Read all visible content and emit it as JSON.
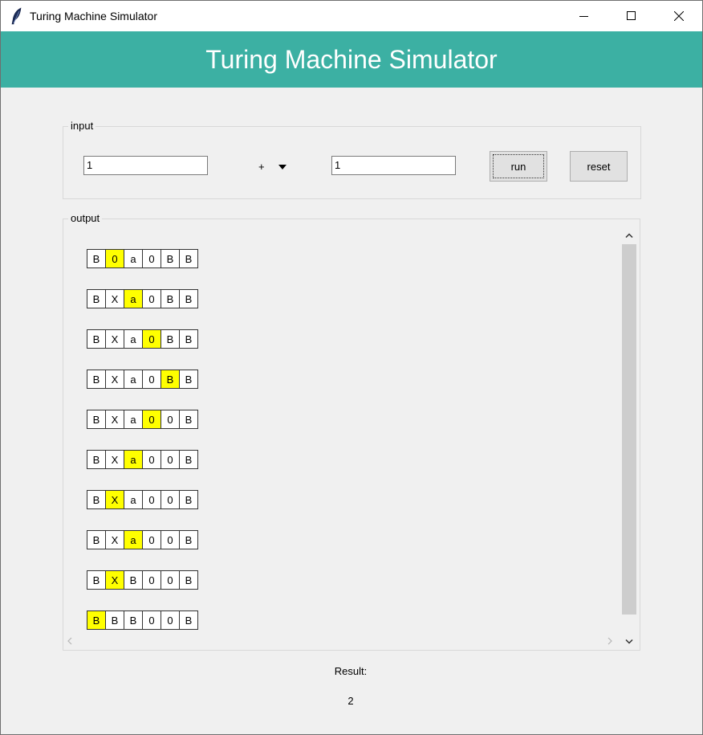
{
  "window": {
    "title": "Turing Machine Simulator",
    "app_icon": "feather-icon",
    "controls": [
      "minimize-icon",
      "maximize-icon",
      "close-icon"
    ]
  },
  "banner": {
    "title": "Turing Machine Simulator",
    "background_color": "#3cb0a3",
    "text_color": "#ffffff"
  },
  "input": {
    "legend": "input",
    "operand_a": "1",
    "operator": "+",
    "operator_icon": "caret-down-icon",
    "operand_b": "1",
    "run_label": "run",
    "reset_label": "reset"
  },
  "output": {
    "legend": "output",
    "head_color": "#ffff00",
    "tapes": [
      {
        "cells": [
          "B",
          "0",
          "a",
          "0",
          "B",
          "B"
        ],
        "head": 1
      },
      {
        "cells": [
          "B",
          "X",
          "a",
          "0",
          "B",
          "B"
        ],
        "head": 2
      },
      {
        "cells": [
          "B",
          "X",
          "a",
          "0",
          "B",
          "B"
        ],
        "head": 3
      },
      {
        "cells": [
          "B",
          "X",
          "a",
          "0",
          "B",
          "B"
        ],
        "head": 4
      },
      {
        "cells": [
          "B",
          "X",
          "a",
          "0",
          "0",
          "B"
        ],
        "head": 3
      },
      {
        "cells": [
          "B",
          "X",
          "a",
          "0",
          "0",
          "B"
        ],
        "head": 2
      },
      {
        "cells": [
          "B",
          "X",
          "a",
          "0",
          "0",
          "B"
        ],
        "head": 1
      },
      {
        "cells": [
          "B",
          "X",
          "a",
          "0",
          "0",
          "B"
        ],
        "head": 2
      },
      {
        "cells": [
          "B",
          "X",
          "B",
          "0",
          "0",
          "B"
        ],
        "head": 1
      },
      {
        "cells": [
          "B",
          "B",
          "B",
          "0",
          "0",
          "B"
        ],
        "head": 0
      }
    ]
  },
  "result": {
    "label": "Result:",
    "value": "2"
  }
}
